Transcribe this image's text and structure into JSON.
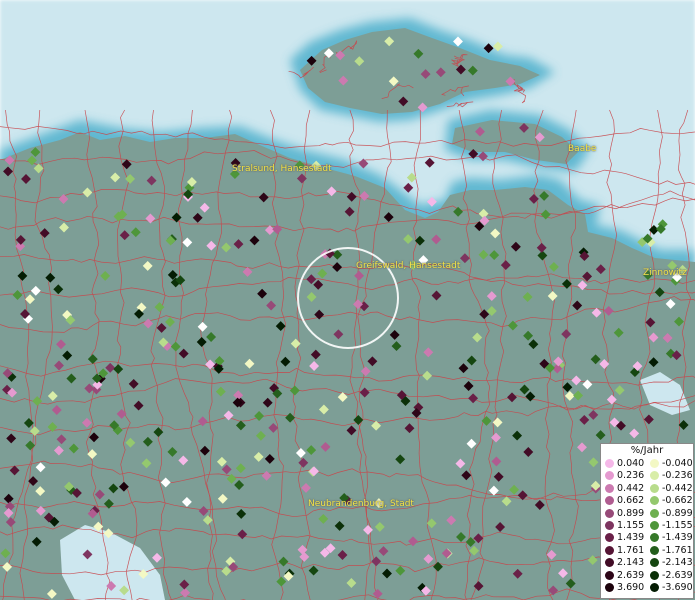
{
  "map": {
    "places": [
      {
        "name": "Stralsund, Hansestadt"
      },
      {
        "name": "Greifswald, Hansestadt"
      },
      {
        "name": "Neubrandenburg, Stadt"
      },
      {
        "name": "Baabe"
      },
      {
        "name": "Zinnowitz"
      }
    ]
  },
  "legend": {
    "title": "%/Jahr",
    "positive": [
      {
        "label": "0.040",
        "color": "#f5b8e8"
      },
      {
        "label": "0.236",
        "color": "#e59ad0"
      },
      {
        "label": "0.442",
        "color": "#cc7ab0"
      },
      {
        "label": "0.662",
        "color": "#b05c90"
      },
      {
        "label": "0.899",
        "color": "#974a78"
      },
      {
        "label": "1.155",
        "color": "#7e3560"
      },
      {
        "label": "1.439",
        "color": "#6a2048"
      },
      {
        "label": "1.761",
        "color": "#561535"
      },
      {
        "label": "2.143",
        "color": "#420c26"
      },
      {
        "label": "2.639",
        "color": "#2e0618"
      },
      {
        "label": "3.690",
        "color": "#1c020c"
      }
    ],
    "negative": [
      {
        "label": "-0.040",
        "color": "#f3f8c4"
      },
      {
        "label": "-0.236",
        "color": "#d8eda8"
      },
      {
        "label": "-0.442",
        "color": "#b8dc8c"
      },
      {
        "label": "-0.662",
        "color": "#94c86e"
      },
      {
        "label": "-0.899",
        "color": "#6eb050"
      },
      {
        "label": "-1.155",
        "color": "#4e963a"
      },
      {
        "label": "-1.439",
        "color": "#36792a"
      },
      {
        "label": "-1.761",
        "color": "#245e1c"
      },
      {
        "label": "-2.143",
        "color": "#154610"
      },
      {
        "label": "-2.639",
        "color": "#0b3008"
      },
      {
        "label": "-3.690",
        "color": "#041c03"
      }
    ]
  },
  "colors": {
    "land": "#7d9e96",
    "sea": "#cde7ef",
    "coast": "#4fb0cc",
    "borders": "#c8464b",
    "place_text": "#f2e64a"
  }
}
